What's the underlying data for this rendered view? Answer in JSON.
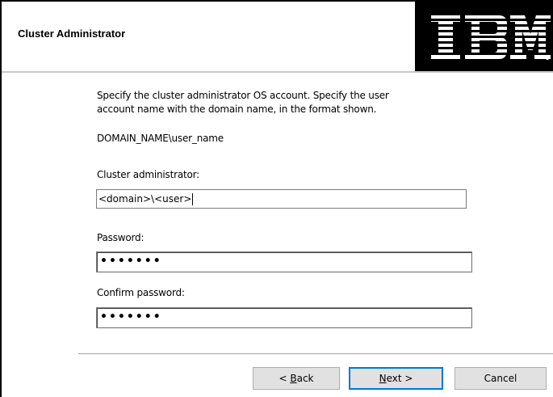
{
  "dialog": {
    "title": "Cluster Administrator",
    "logo_text": "IBM"
  },
  "content": {
    "intro_line1": "Specify the cluster administrator OS account. Specify the user",
    "intro_line2": "account name with the domain name, in the format shown.",
    "format_example": "DOMAIN_NAME\\user_name",
    "admin_label": "Cluster administrator:",
    "admin_value": "<domain>\\<user>",
    "password_label": "Password:",
    "password_value": "•••••••",
    "confirm_label": "Confirm password:",
    "confirm_value": "•••••••"
  },
  "buttons": {
    "back_pre": "< ",
    "back_mnemonic": "B",
    "back_post": "ack",
    "next_mnemonic": "N",
    "next_post": "ext >",
    "cancel": "Cancel"
  }
}
